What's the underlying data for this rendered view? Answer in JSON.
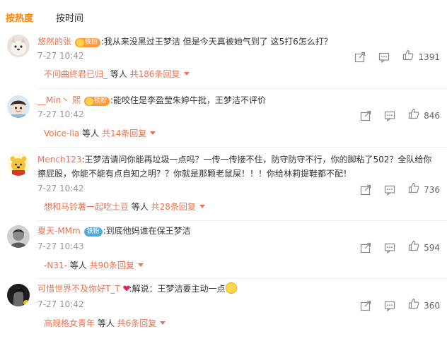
{
  "tabs": [
    {
      "label": "按热度"
    },
    {
      "label": "按时间"
    }
  ],
  "comments": [
    {
      "username": "悠然的张",
      "badge": "铁粉",
      "text": ":我从来没黑过王梦洁 但是今天真被她气到了 这5打6怎么打？",
      "time": "7-27 10:42",
      "likes": "1391",
      "reply_name": "不问曲终君已归_",
      "reply_mid": " 等人 ",
      "reply_count": "共186条回复"
    },
    {
      "username": "__Min丶 熙",
      "badge": "铁粉",
      "text": ":能咬住是李盈莹朱婷牛批，王梦洁不评价",
      "time": "7-27 10:42",
      "likes": "846",
      "reply_name": "Voice-lia",
      "reply_mid": " 等人 ",
      "reply_count": "共14条回复"
    },
    {
      "username": "Mench123",
      "text_line1": ":王梦洁请问你能再垃圾一点吗？一传一传接不住，防守防守不行，你的脚粘了502？全队给你",
      "text_line2": "擦屁股，你能不能有点自知之明？？你就是那颗老鼠屎！！！你给林莉提鞋都不配！",
      "time": "7-27 10:42",
      "likes": "736",
      "reply_name": "想和马铃薯一起吃土豆",
      "reply_mid": " 等人 ",
      "reply_count": "共28条回复"
    },
    {
      "username": "夏天-MMm",
      "badge": "铁粉",
      "text": ":到底他妈谁在保王梦洁",
      "time": "7-27 10:43",
      "likes": "594",
      "reply_name": "-N31-",
      "reply_mid": " 等人 ",
      "reply_count": "共90条回复"
    },
    {
      "username": "可惜世界不及你好T_T",
      "text": ":解说：王梦洁要主动一点",
      "time": "7-27 10:42",
      "likes": "360",
      "reply_name": "高规格女青年",
      "reply_mid": " 等人 ",
      "reply_count": "共6条回复"
    }
  ],
  "icons": {
    "share": "share-icon",
    "comment": "comment-icon",
    "like": "thumbs-up-icon",
    "expand": "triangle-down-icon",
    "heart": "heart-icon",
    "emoji": "smile-emoji-icon"
  },
  "colors": {
    "accent": "#ff8200",
    "link": "#eb7350",
    "muted": "#999999"
  }
}
